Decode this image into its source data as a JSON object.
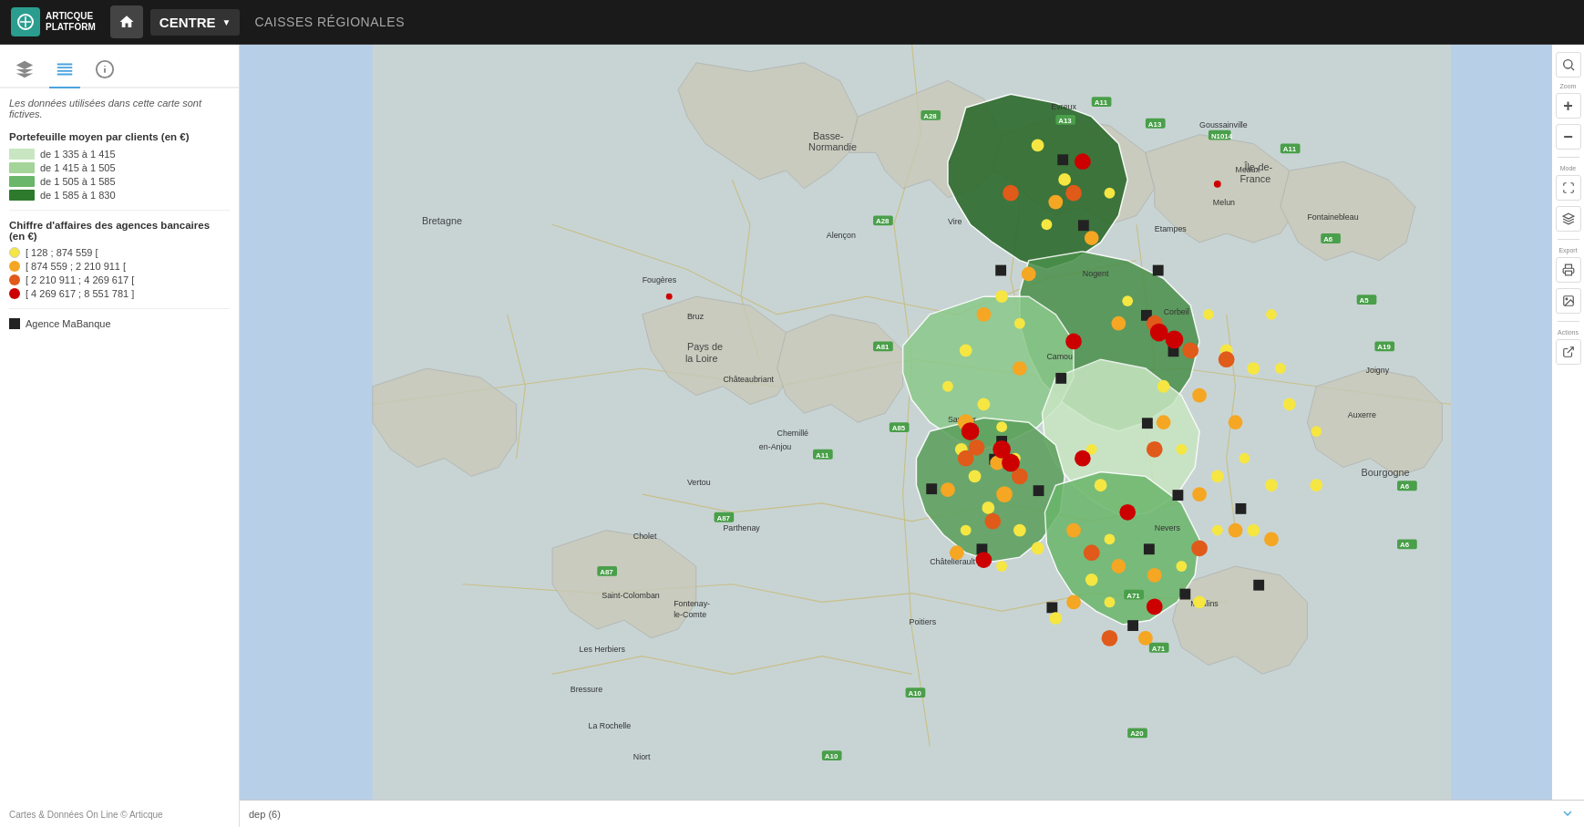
{
  "header": {
    "logo_line1": "ARTICQUE",
    "logo_line2": "PLATFORM",
    "nav_centre": "CENTRE",
    "nav_dropdown_icon": "▼",
    "nav_caisses": "CAISSES RÉGIONALES"
  },
  "sidebar": {
    "tabs": [
      {
        "id": "layers",
        "icon": "layers",
        "active": false
      },
      {
        "id": "list",
        "icon": "list",
        "active": true
      },
      {
        "id": "info",
        "icon": "info",
        "active": false
      }
    ],
    "fictive_note": "Les données utilisées dans cette carte sont fictives.",
    "portefeuille_title": "Portefeuille moyen par clients (en €)",
    "portefeuille_items": [
      {
        "color": "#c8e6c2",
        "label": "de 1 335 à 1 415"
      },
      {
        "color": "#a5d49a",
        "label": "de 1 415 à 1 505"
      },
      {
        "color": "#6ab66a",
        "label": "de 1 505 à 1 585"
      },
      {
        "color": "#2d7a2d",
        "label": "de 1 585 à 1 830"
      }
    ],
    "chiffre_title": "Chiffre d'affaires des agences bancaires (en €)",
    "chiffre_items": [
      {
        "color": "#f5e642",
        "label": "[ 128 ; 874 559 ["
      },
      {
        "color": "#f5a623",
        "label": "[ 874 559 ; 2 210 911 ["
      },
      {
        "color": "#e05a1a",
        "label": "[ 2 210 911 ; 4 269 617 ["
      },
      {
        "color": "#cc0000",
        "label": "[ 4 269 617 ; 8 551 781 ]"
      }
    ],
    "agence_label": "Agence MaBanque"
  },
  "map": {
    "bottom_label": "dep (6)",
    "zoom_in": "+",
    "zoom_out": "−"
  },
  "toolbar": {
    "items": [
      {
        "id": "search",
        "icon": "🔍",
        "label": "Zoom"
      },
      {
        "id": "zoom-in",
        "icon": "+",
        "label": ""
      },
      {
        "id": "zoom-out",
        "icon": "−",
        "label": ""
      },
      {
        "id": "fullscreen",
        "icon": "⤢",
        "label": "Mode"
      },
      {
        "id": "layers2",
        "icon": "⊞",
        "label": ""
      },
      {
        "id": "export",
        "icon": "🖨",
        "label": "Export"
      },
      {
        "id": "image",
        "icon": "🖼",
        "label": ""
      },
      {
        "id": "action",
        "icon": "↗",
        "label": "Actions"
      }
    ]
  },
  "footer": {
    "credit": "Cartes & Données On Line © Articque"
  }
}
